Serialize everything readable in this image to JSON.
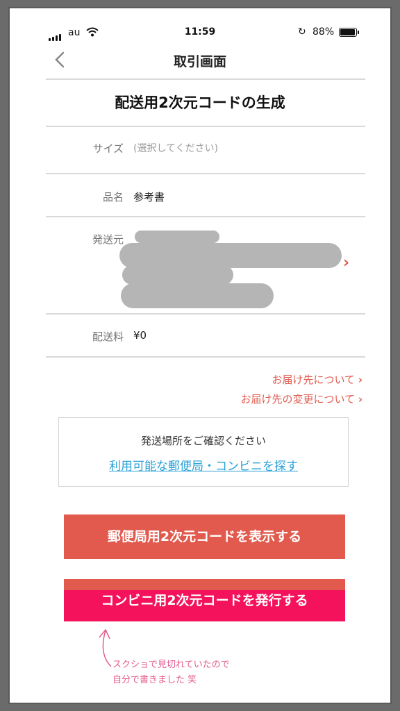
{
  "status_bar": {
    "carrier": "au",
    "time": "11:59",
    "battery_percent": "88%"
  },
  "nav": {
    "title": "取引画面"
  },
  "heading": "配送用2次元コードの生成",
  "fields": {
    "size_label": "サイズ",
    "size_placeholder": "(選択してください)",
    "item_label": "品名",
    "item_value": "参考書",
    "origin_label": "発送元",
    "shipping_fee_label": "配送料",
    "shipping_fee_value": "¥0"
  },
  "links": {
    "delivery_info": "お届け先について",
    "delivery_change": "お届け先の変更について"
  },
  "confirm": {
    "text": "発送場所をご確認ください",
    "link": "利用可能な郵便局・コンビニを探す"
  },
  "buttons": {
    "post_office": "郵便局用2次元コードを表示する",
    "combini": "コンビニ用2次元コードを発行する"
  },
  "note": {
    "line1": "スクショで見切れていたので",
    "line2": "自分で書きました 笑"
  },
  "colors": {
    "accent_red": "#e15a4d",
    "combini_pink": "#f4125c",
    "link_blue": "#2aa1d8",
    "note_pink": "#e35c8e"
  }
}
